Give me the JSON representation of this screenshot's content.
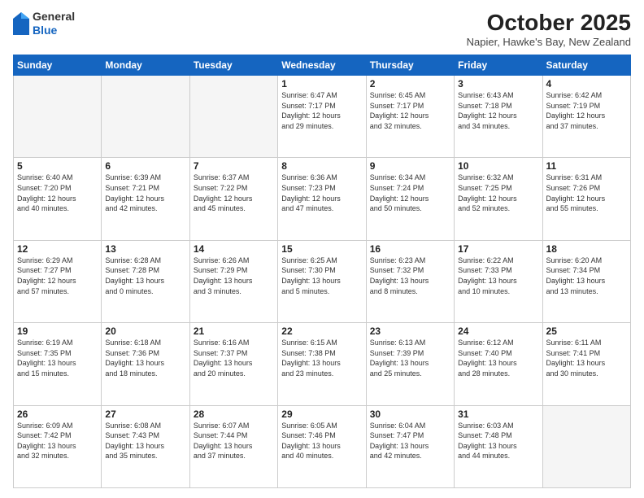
{
  "header": {
    "logo_general": "General",
    "logo_blue": "Blue",
    "month_year": "October 2025",
    "location": "Napier, Hawke's Bay, New Zealand"
  },
  "weekdays": [
    "Sunday",
    "Monday",
    "Tuesday",
    "Wednesday",
    "Thursday",
    "Friday",
    "Saturday"
  ],
  "weeks": [
    [
      {
        "day": "",
        "info": ""
      },
      {
        "day": "",
        "info": ""
      },
      {
        "day": "",
        "info": ""
      },
      {
        "day": "1",
        "info": "Sunrise: 6:47 AM\nSunset: 7:17 PM\nDaylight: 12 hours\nand 29 minutes."
      },
      {
        "day": "2",
        "info": "Sunrise: 6:45 AM\nSunset: 7:17 PM\nDaylight: 12 hours\nand 32 minutes."
      },
      {
        "day": "3",
        "info": "Sunrise: 6:43 AM\nSunset: 7:18 PM\nDaylight: 12 hours\nand 34 minutes."
      },
      {
        "day": "4",
        "info": "Sunrise: 6:42 AM\nSunset: 7:19 PM\nDaylight: 12 hours\nand 37 minutes."
      }
    ],
    [
      {
        "day": "5",
        "info": "Sunrise: 6:40 AM\nSunset: 7:20 PM\nDaylight: 12 hours\nand 40 minutes."
      },
      {
        "day": "6",
        "info": "Sunrise: 6:39 AM\nSunset: 7:21 PM\nDaylight: 12 hours\nand 42 minutes."
      },
      {
        "day": "7",
        "info": "Sunrise: 6:37 AM\nSunset: 7:22 PM\nDaylight: 12 hours\nand 45 minutes."
      },
      {
        "day": "8",
        "info": "Sunrise: 6:36 AM\nSunset: 7:23 PM\nDaylight: 12 hours\nand 47 minutes."
      },
      {
        "day": "9",
        "info": "Sunrise: 6:34 AM\nSunset: 7:24 PM\nDaylight: 12 hours\nand 50 minutes."
      },
      {
        "day": "10",
        "info": "Sunrise: 6:32 AM\nSunset: 7:25 PM\nDaylight: 12 hours\nand 52 minutes."
      },
      {
        "day": "11",
        "info": "Sunrise: 6:31 AM\nSunset: 7:26 PM\nDaylight: 12 hours\nand 55 minutes."
      }
    ],
    [
      {
        "day": "12",
        "info": "Sunrise: 6:29 AM\nSunset: 7:27 PM\nDaylight: 12 hours\nand 57 minutes."
      },
      {
        "day": "13",
        "info": "Sunrise: 6:28 AM\nSunset: 7:28 PM\nDaylight: 13 hours\nand 0 minutes."
      },
      {
        "day": "14",
        "info": "Sunrise: 6:26 AM\nSunset: 7:29 PM\nDaylight: 13 hours\nand 3 minutes."
      },
      {
        "day": "15",
        "info": "Sunrise: 6:25 AM\nSunset: 7:30 PM\nDaylight: 13 hours\nand 5 minutes."
      },
      {
        "day": "16",
        "info": "Sunrise: 6:23 AM\nSunset: 7:32 PM\nDaylight: 13 hours\nand 8 minutes."
      },
      {
        "day": "17",
        "info": "Sunrise: 6:22 AM\nSunset: 7:33 PM\nDaylight: 13 hours\nand 10 minutes."
      },
      {
        "day": "18",
        "info": "Sunrise: 6:20 AM\nSunset: 7:34 PM\nDaylight: 13 hours\nand 13 minutes."
      }
    ],
    [
      {
        "day": "19",
        "info": "Sunrise: 6:19 AM\nSunset: 7:35 PM\nDaylight: 13 hours\nand 15 minutes."
      },
      {
        "day": "20",
        "info": "Sunrise: 6:18 AM\nSunset: 7:36 PM\nDaylight: 13 hours\nand 18 minutes."
      },
      {
        "day": "21",
        "info": "Sunrise: 6:16 AM\nSunset: 7:37 PM\nDaylight: 13 hours\nand 20 minutes."
      },
      {
        "day": "22",
        "info": "Sunrise: 6:15 AM\nSunset: 7:38 PM\nDaylight: 13 hours\nand 23 minutes."
      },
      {
        "day": "23",
        "info": "Sunrise: 6:13 AM\nSunset: 7:39 PM\nDaylight: 13 hours\nand 25 minutes."
      },
      {
        "day": "24",
        "info": "Sunrise: 6:12 AM\nSunset: 7:40 PM\nDaylight: 13 hours\nand 28 minutes."
      },
      {
        "day": "25",
        "info": "Sunrise: 6:11 AM\nSunset: 7:41 PM\nDaylight: 13 hours\nand 30 minutes."
      }
    ],
    [
      {
        "day": "26",
        "info": "Sunrise: 6:09 AM\nSunset: 7:42 PM\nDaylight: 13 hours\nand 32 minutes."
      },
      {
        "day": "27",
        "info": "Sunrise: 6:08 AM\nSunset: 7:43 PM\nDaylight: 13 hours\nand 35 minutes."
      },
      {
        "day": "28",
        "info": "Sunrise: 6:07 AM\nSunset: 7:44 PM\nDaylight: 13 hours\nand 37 minutes."
      },
      {
        "day": "29",
        "info": "Sunrise: 6:05 AM\nSunset: 7:46 PM\nDaylight: 13 hours\nand 40 minutes."
      },
      {
        "day": "30",
        "info": "Sunrise: 6:04 AM\nSunset: 7:47 PM\nDaylight: 13 hours\nand 42 minutes."
      },
      {
        "day": "31",
        "info": "Sunrise: 6:03 AM\nSunset: 7:48 PM\nDaylight: 13 hours\nand 44 minutes."
      },
      {
        "day": "",
        "info": ""
      }
    ]
  ]
}
